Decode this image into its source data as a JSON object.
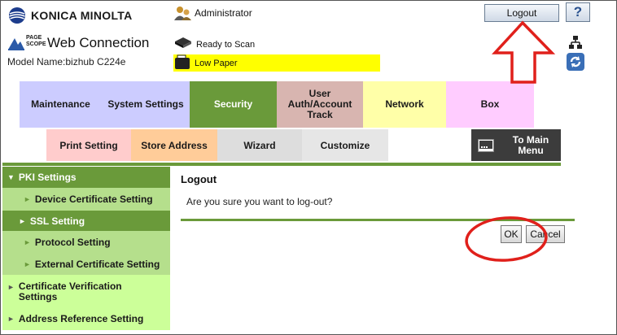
{
  "header": {
    "brand": "KONICA MINOLTA",
    "pagescope_logo": "PAGE SCOPE",
    "web_connection": "Web Connection",
    "model_name": "Model Name:bizhub C224e",
    "user": "Administrator",
    "logout_label": "Logout",
    "help_label": "?",
    "status_scan": "Ready to Scan",
    "status_paper": "Low Paper"
  },
  "tabs": [
    {
      "label": "Maintenance",
      "color": "#ccccff"
    },
    {
      "label": "System Settings",
      "color": "#ccccff"
    },
    {
      "label": "Security",
      "color": "#6a9a3a",
      "active": true
    },
    {
      "label": "User Auth/Account Track",
      "color": "#d8b5b0"
    },
    {
      "label": "Network",
      "color": "#ffffa8"
    },
    {
      "label": "Box",
      "color": "#ffccff"
    }
  ],
  "subtabs": [
    {
      "label": "Print Setting",
      "color": "#ffcccc"
    },
    {
      "label": "Store Address",
      "color": "#ffcc99"
    },
    {
      "label": "Wizard",
      "color": "#dddddd"
    },
    {
      "label": "Customize",
      "color": "#e6e6e6"
    }
  ],
  "main_menu_label": "To Main Menu",
  "sidebar": {
    "items": [
      {
        "label": "PKI Settings",
        "level": 0,
        "arrow": "▼",
        "bg": "#6a9a3a",
        "fg": "#ffffff"
      },
      {
        "label": "Device Certificate Setting",
        "level": 1,
        "arrow": "►",
        "bg": "#b5df8c",
        "fg": "#1a1a1a"
      },
      {
        "label": "SSL Setting",
        "level": 1,
        "arrow": "►",
        "bg": "#6a9a3a",
        "fg": "#ffffff"
      },
      {
        "label": "Protocol Setting",
        "level": 1,
        "arrow": "►",
        "bg": "#b5df8c",
        "fg": "#1a1a1a"
      },
      {
        "label": "External Certificate Setting",
        "level": 1,
        "arrow": "►",
        "bg": "#b5df8c",
        "fg": "#1a1a1a"
      },
      {
        "label": "Certificate Verification Settings",
        "level": 0,
        "arrow": "►",
        "bg": "#ccff99",
        "fg": "#1a1a1a"
      },
      {
        "label": "Address Reference Setting",
        "level": 0,
        "arrow": "►",
        "bg": "#ccff99",
        "fg": "#1a1a1a"
      }
    ]
  },
  "main": {
    "title": "Logout",
    "message": "Are you sure you want to log-out?",
    "ok_label": "OK",
    "cancel_label": "Cancel"
  },
  "colors": {
    "accent_green": "#6a9a3a",
    "annotation_red": "#e0201b",
    "low_paper_yellow": "#ffff00"
  }
}
